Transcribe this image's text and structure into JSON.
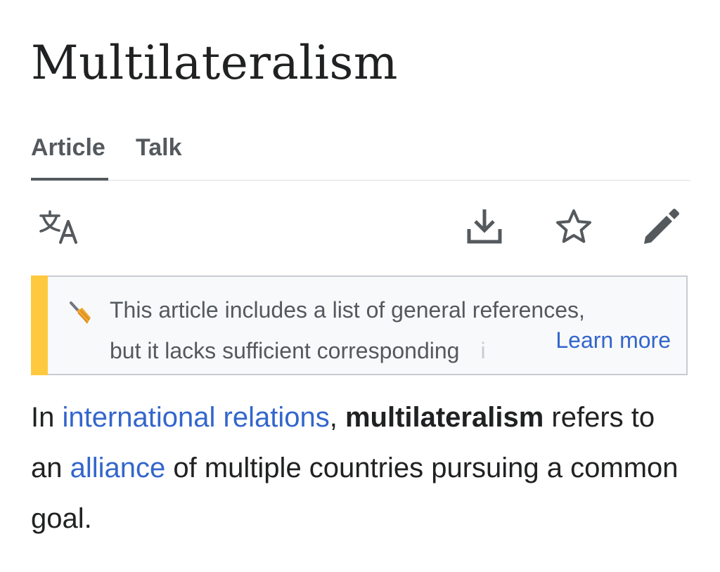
{
  "page": {
    "title": "Multilateralism"
  },
  "tabs": [
    {
      "label": "Article",
      "active": true
    },
    {
      "label": "Talk",
      "active": false
    }
  ],
  "toolbar": {
    "language_icon": "translate-icon",
    "download_icon": "download-icon",
    "watch_icon": "star-icon",
    "edit_icon": "pencil-icon"
  },
  "notice": {
    "icon": "broom-icon",
    "line1": "This article includes a list of general references,",
    "line2": "but it lacks sufficient corresponding",
    "line2_faded": "i",
    "learn_more": "Learn more",
    "accent_color": "#fec93e"
  },
  "content": {
    "p1_start": "In ",
    "link1": "international relations",
    "p1_comma": ", ",
    "bold_term": "multilateralism",
    "p1_mid": " refers to an ",
    "link2": "alliance",
    "p1_end": " of multiple countries pursuing a common goal."
  },
  "colors": {
    "link": "#3366cc",
    "text": "#202122",
    "muted": "#54595d"
  }
}
